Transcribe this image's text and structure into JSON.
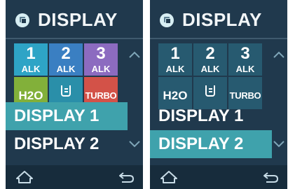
{
  "screens": [
    {
      "header": {
        "title": "DISPLAY",
        "icon": "display-icon"
      },
      "tiles": [
        {
          "num": "1",
          "sub": "ALK",
          "color": "#2ea4c6"
        },
        {
          "num": "2",
          "sub": "ALK",
          "color": "#3a7fc2"
        },
        {
          "num": "3",
          "sub": "ALK",
          "color": "#8c6bc0"
        },
        {
          "label": "H2O",
          "color": "#82b03a"
        },
        {
          "icon": "cup-icon",
          "color": "#2a8fa9"
        },
        {
          "label": "TURBO",
          "color": "#d35248"
        }
      ],
      "menu": [
        {
          "label": "DISPLAY 1",
          "selected": true
        },
        {
          "label": "DISPLAY 2",
          "selected": false
        }
      ]
    },
    {
      "header": {
        "title": "DISPLAY",
        "icon": "display-icon"
      },
      "tiles": [
        {
          "num": "1",
          "sub": "ALK",
          "color": "#275a70"
        },
        {
          "num": "2",
          "sub": "ALK",
          "color": "#275a70"
        },
        {
          "num": "3",
          "sub": "ALK",
          "color": "#275a70"
        },
        {
          "label": "H2O",
          "color": "#275a70"
        },
        {
          "icon": "cup-icon",
          "color": "#275a70"
        },
        {
          "label": "TURBO",
          "color": "#275a70"
        }
      ],
      "menu": [
        {
          "label": "DISPLAY 1",
          "selected": false
        },
        {
          "label": "DISPLAY 2",
          "selected": true
        }
      ]
    }
  ],
  "icons": {
    "scroll_up": "chevron-up-icon",
    "scroll_down": "chevron-down-icon",
    "home": "home-icon",
    "back": "back-icon"
  },
  "colors": {
    "background": "#20394d",
    "selected_row": "#3fa2ac",
    "footer": "#172c3c"
  }
}
